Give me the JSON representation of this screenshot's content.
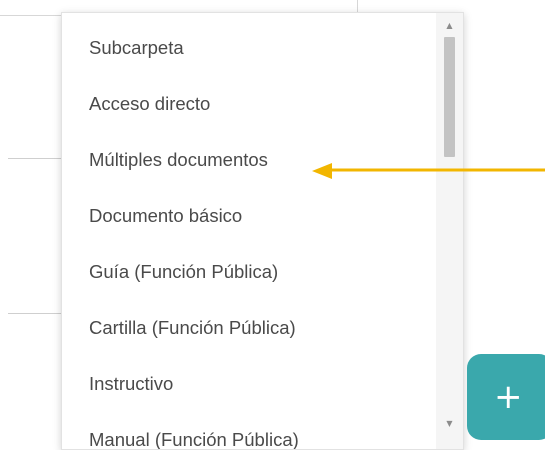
{
  "menu": {
    "items": [
      {
        "label": "Subcarpeta"
      },
      {
        "label": "Acceso directo"
      },
      {
        "label": "Múltiples documentos"
      },
      {
        "label": "Documento básico"
      },
      {
        "label": "Guía (Función Pública)"
      },
      {
        "label": "Cartilla (Función Pública)"
      },
      {
        "label": "Instructivo"
      },
      {
        "label": "Manual (Función Pública)"
      }
    ]
  },
  "fab": {
    "label": "+"
  },
  "annotation": {
    "color": "#f2b600",
    "icon": "arrow-left-icon"
  },
  "colors": {
    "accent": "#3aa8ac",
    "menu_text": "#4a4a4a"
  }
}
